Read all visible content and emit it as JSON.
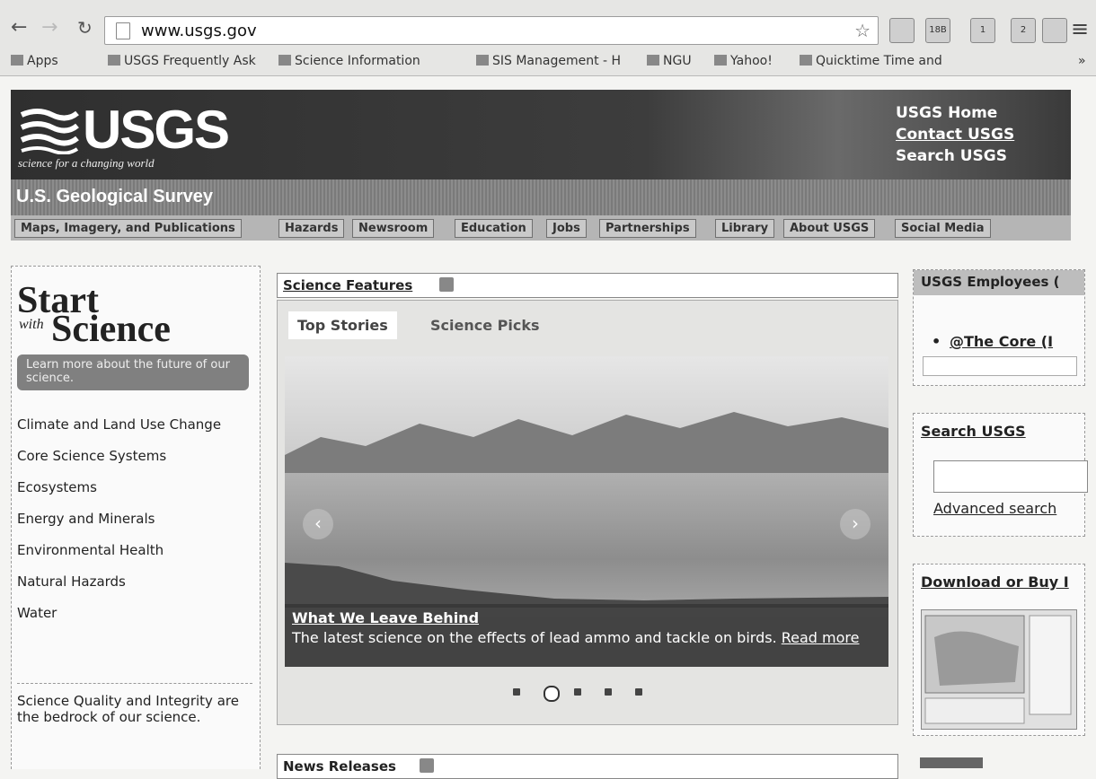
{
  "browser": {
    "url": "www.usgs.gov",
    "bookmarks": {
      "apps": "Apps",
      "items": [
        "USGS Frequently Ask",
        "Science Information",
        "SIS Management - H",
        "NGU",
        "Yahoo!",
        "Quicktime Time and"
      ],
      "more": "»"
    },
    "extensions": [
      "",
      "18B",
      "1",
      "2",
      ""
    ]
  },
  "header": {
    "logo": "USGS",
    "tagline": "science for a changing world",
    "links": [
      "USGS Home",
      "Contact USGS",
      "Search USGS"
    ],
    "survey_title": "U.S. Geological Survey",
    "nav": [
      "Maps, Imagery, and Publications",
      "Hazards",
      "Newsroom",
      "Education",
      "Jobs",
      "Partnerships",
      "Library",
      "About USGS",
      "Social Media"
    ]
  },
  "sidebar": {
    "start": "Start",
    "with": "with",
    "science": "Science",
    "learn_more": "Learn more about the future of our science.",
    "topics": [
      "Climate and Land Use Change",
      "Core Science Systems",
      "Ecosystems",
      "Energy and Minerals",
      "Environmental Health",
      "Natural Hazards",
      "Water"
    ],
    "quality": "Science Quality and Integrity are the bedrock of our science."
  },
  "features": {
    "title": "Science Features",
    "tabs": [
      "Top Stories",
      "Science Picks"
    ],
    "story_title": "What We Leave Behind",
    "story_text": "The latest science on the effects of lead ammo and tackle on birds.",
    "read": "Read",
    "more": "more",
    "slide_count": 5,
    "active_slide": 2
  },
  "news": {
    "title": "News Releases"
  },
  "right": {
    "employees_title": "USGS Employees (",
    "employees_link": "@The Core (I",
    "search_title": "Search USGS",
    "advanced": "Advanced search",
    "download_title": "Download or Buy I"
  }
}
